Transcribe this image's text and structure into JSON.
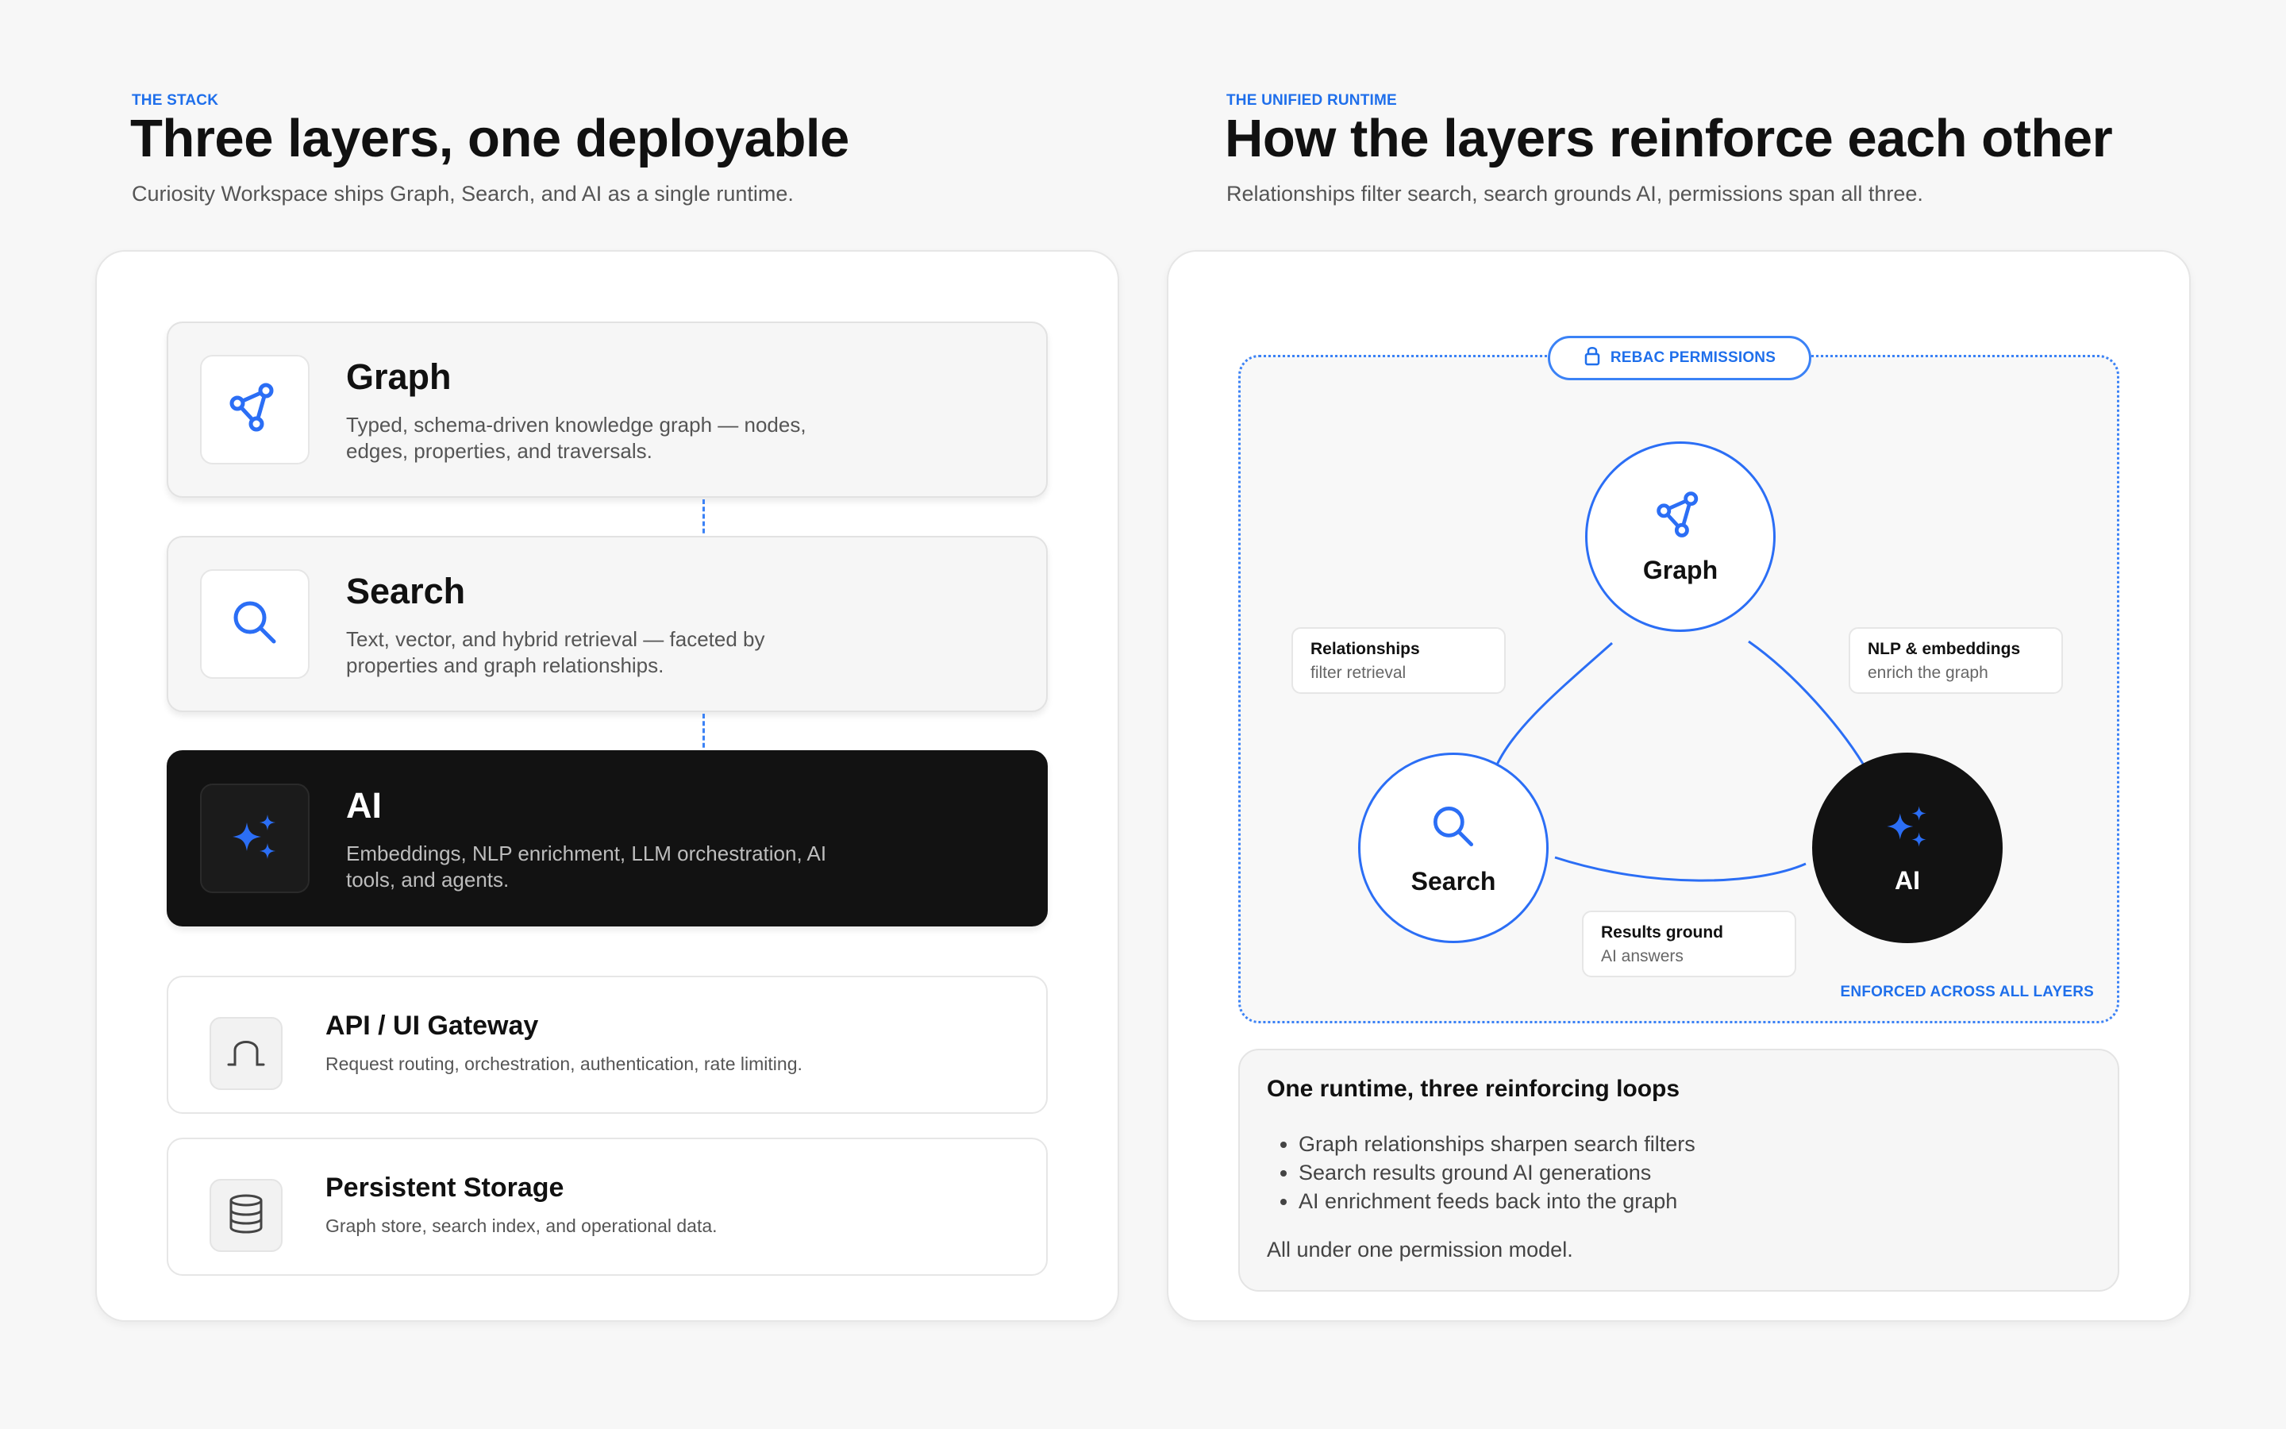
{
  "left": {
    "eyebrow": "THE STACK",
    "title": "Three layers, one deployable",
    "subtitle": "Curiosity Workspace ships Graph, Search, and AI as a single runtime.",
    "layers": [
      {
        "title": "Graph",
        "desc": "Typed, schema-driven knowledge graph — nodes, edges, properties, and traversals.",
        "icon": "graph-icon"
      },
      {
        "title": "Search",
        "desc": "Text, vector, and hybrid retrieval — faceted by properties and graph relationships.",
        "icon": "search-icon"
      },
      {
        "title": "AI",
        "desc": "Embeddings, NLP enrichment, LLM orchestration, AI tools, and agents.",
        "icon": "sparkles-icon"
      }
    ],
    "infra": [
      {
        "title": "API / UI Gateway",
        "desc": "Request routing, orchestration, authentication, rate limiting.",
        "icon": "gateway-icon"
      },
      {
        "title": "Persistent Storage",
        "desc": "Graph store, search index, and operational data.",
        "icon": "database-icon"
      }
    ]
  },
  "right": {
    "eyebrow": "THE UNIFIED RUNTIME",
    "title": "How the layers reinforce each other",
    "subtitle": "Relationships filter search, search grounds AI, permissions span all three.",
    "rebac_label": "REBAC PERMISSIONS",
    "enforced_label": "ENFORCED ACROSS ALL LAYERS",
    "nodes": {
      "graph": "Graph",
      "search": "Search",
      "ai": "AI"
    },
    "edges": {
      "graph_search": {
        "title": "Relationships",
        "sub": "filter retrieval"
      },
      "graph_ai": {
        "title": "NLP & embeddings",
        "sub": "enrich the graph"
      },
      "search_ai": {
        "title": "Results ground",
        "sub": "AI answers"
      }
    },
    "summary": {
      "title": "One runtime, three reinforcing loops",
      "items": [
        "Graph relationships sharpen search filters",
        "Search results ground AI generations",
        "AI enrichment feeds back into the graph"
      ],
      "footer": "All under one permission model."
    }
  },
  "colors": {
    "accent": "#2b6ef5",
    "dark": "#121212",
    "background": "#f7f7f7"
  }
}
